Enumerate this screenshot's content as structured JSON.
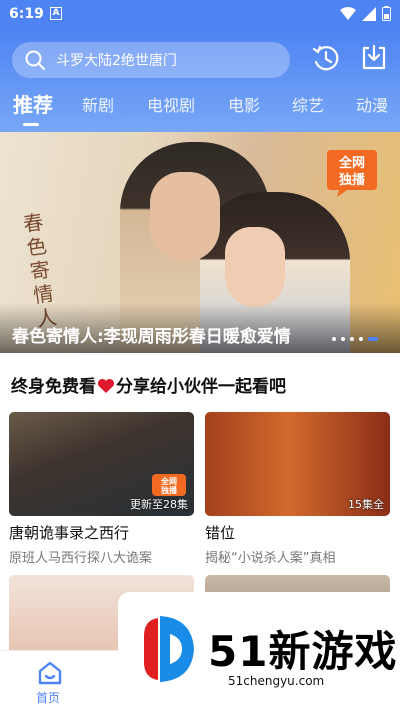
{
  "status_bar": {
    "time": "6:19",
    "notif_glyph": "A"
  },
  "header": {
    "search_placeholder": "斗罗大陆2绝世唐门",
    "tabs": [
      {
        "label": "推荐",
        "active": true
      },
      {
        "label": "新剧",
        "active": false
      },
      {
        "label": "电视剧",
        "active": false
      },
      {
        "label": "电影",
        "active": false
      },
      {
        "label": "综艺",
        "active": false
      },
      {
        "label": "动漫",
        "active": false
      }
    ]
  },
  "banner": {
    "title": "春色寄情人:李现周雨彤春日暖愈爱情",
    "badge_line1": "全网",
    "badge_line2": "独播",
    "calligraphy": "春色寄情人",
    "slides_total": 5,
    "active_slide": 5
  },
  "section": {
    "title_before": "终身免费看",
    "title_after": "分享给小伙伴一起看吧"
  },
  "cards": [
    {
      "title": "唐朝诡事录之西行",
      "subtitle": "原班人马西行探八大诡案",
      "episodes": "更新至28集",
      "badge_line1": "全网",
      "badge_line2": "独播"
    },
    {
      "title": "错位",
      "subtitle": "揭秘“小说杀人案”真相",
      "episodes": "15集全"
    }
  ],
  "bottom_nav": {
    "home_label": "首页"
  },
  "watermark": {
    "text": "51新游戏",
    "url": "51chengyu.com"
  },
  "colors": {
    "brand_blue": "#4e83f3",
    "heart_red": "#e0182d",
    "badge_orange": "#f26a21"
  }
}
